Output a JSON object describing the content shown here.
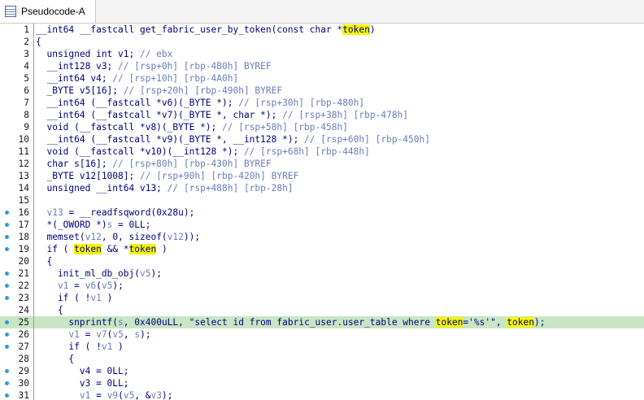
{
  "window": {
    "tab_title": "Pseudocode-A",
    "tab_icon": "pseudocode-window-icon"
  },
  "colors": {
    "keyword": "#000080",
    "comment": "#6b7dbd",
    "highlight_line": "#c8e6c3",
    "token_highlight": "#f5f500",
    "breakpoint_dot": "#2f9bd6"
  },
  "editor": {
    "highlighted_line": 25,
    "lines": [
      {
        "n": "1",
        "bp": false,
        "tokens": [
          [
            "__int64 __fastcall get_fabric_user_by_token(const char *",
            "k"
          ],
          [
            "token",
            "hw"
          ],
          [
            ")",
            "k"
          ]
        ]
      },
      {
        "n": "2",
        "bp": false,
        "tokens": [
          [
            "{",
            "k"
          ]
        ]
      },
      {
        "n": "3",
        "bp": false,
        "tokens": [
          [
            "  unsigned int v1; ",
            "k"
          ],
          [
            "// ebx",
            "c"
          ]
        ]
      },
      {
        "n": "4",
        "bp": false,
        "tokens": [
          [
            "  __int128 v3; ",
            "k"
          ],
          [
            "// [rsp+0h] [rbp-4B0h] BYREF",
            "c"
          ]
        ]
      },
      {
        "n": "5",
        "bp": false,
        "tokens": [
          [
            "  __int64 v4; ",
            "k"
          ],
          [
            "// [rsp+10h] [rbp-4A0h]",
            "c"
          ]
        ]
      },
      {
        "n": "6",
        "bp": false,
        "tokens": [
          [
            "  _BYTE v5[16]; ",
            "k"
          ],
          [
            "// [rsp+20h] [rbp-490h] BYREF",
            "c"
          ]
        ]
      },
      {
        "n": "7",
        "bp": false,
        "tokens": [
          [
            "  __int64 (__fastcall *v6)(_BYTE *); ",
            "k"
          ],
          [
            "// [rsp+30h] [rbp-480h]",
            "c"
          ]
        ]
      },
      {
        "n": "8",
        "bp": false,
        "tokens": [
          [
            "  __int64 (__fastcall *v7)(_BYTE *, char *); ",
            "k"
          ],
          [
            "// [rsp+38h] [rbp-478h]",
            "c"
          ]
        ]
      },
      {
        "n": "9",
        "bp": false,
        "tokens": [
          [
            "  void (__fastcall *v8)(_BYTE *); ",
            "k"
          ],
          [
            "// [rsp+58h] [rbp-458h]",
            "c"
          ]
        ]
      },
      {
        "n": "10",
        "bp": false,
        "tokens": [
          [
            "  __int64 (__fastcall *v9)(_BYTE *, __int128 *); ",
            "k"
          ],
          [
            "// [rsp+60h] [rbp-450h]",
            "c"
          ]
        ]
      },
      {
        "n": "11",
        "bp": false,
        "tokens": [
          [
            "  void (__fastcall *v10)(__int128 *); ",
            "k"
          ],
          [
            "// [rsp+68h] [rbp-448h]",
            "c"
          ]
        ]
      },
      {
        "n": "12",
        "bp": false,
        "tokens": [
          [
            "  char s[16]; ",
            "k"
          ],
          [
            "// [rsp+80h] [rbp-430h] BYREF",
            "c"
          ]
        ]
      },
      {
        "n": "13",
        "bp": false,
        "tokens": [
          [
            "  _BYTE v12[1008]; ",
            "k"
          ],
          [
            "// [rsp+90h] [rbp-420h] BYREF",
            "c"
          ]
        ]
      },
      {
        "n": "14",
        "bp": false,
        "tokens": [
          [
            "  unsigned __int64 v13; ",
            "k"
          ],
          [
            "// [rsp+488h] [rbp-28h]",
            "c"
          ]
        ]
      },
      {
        "n": "15",
        "bp": false,
        "tokens": []
      },
      {
        "n": "16",
        "bp": true,
        "tokens": [
          [
            "  ",
            "k"
          ],
          [
            "v13",
            "v"
          ],
          [
            " = __readfsqword(0x28u);",
            "k"
          ]
        ]
      },
      {
        "n": "17",
        "bp": true,
        "tokens": [
          [
            "  *(_OWORD *)",
            "k"
          ],
          [
            "s",
            "v"
          ],
          [
            " = 0LL;",
            "k"
          ]
        ]
      },
      {
        "n": "18",
        "bp": true,
        "tokens": [
          [
            "  memset(",
            "k"
          ],
          [
            "v12",
            "v"
          ],
          [
            ", 0, sizeof(",
            "k"
          ],
          [
            "v12",
            "v"
          ],
          [
            "));",
            "k"
          ]
        ]
      },
      {
        "n": "19",
        "bp": true,
        "tokens": [
          [
            "  if ( ",
            "k"
          ],
          [
            "token",
            "hw"
          ],
          [
            " && *",
            "k"
          ],
          [
            "token",
            "hw"
          ],
          [
            " )",
            "k"
          ]
        ]
      },
      {
        "n": "20",
        "bp": false,
        "tokens": [
          [
            "  {",
            "k"
          ]
        ]
      },
      {
        "n": "21",
        "bp": true,
        "tokens": [
          [
            "    init_ml_db_obj(",
            "k"
          ],
          [
            "v5",
            "v"
          ],
          [
            ");",
            "k"
          ]
        ]
      },
      {
        "n": "22",
        "bp": true,
        "tokens": [
          [
            "    ",
            "k"
          ],
          [
            "v1",
            "v"
          ],
          [
            " = ",
            "k"
          ],
          [
            "v6",
            "v"
          ],
          [
            "(",
            "k"
          ],
          [
            "v5",
            "v"
          ],
          [
            ");",
            "k"
          ]
        ]
      },
      {
        "n": "23",
        "bp": true,
        "tokens": [
          [
            "    if ( !",
            "k"
          ],
          [
            "v1",
            "v"
          ],
          [
            " )",
            "k"
          ]
        ]
      },
      {
        "n": "24",
        "bp": false,
        "tokens": [
          [
            "    {",
            "k"
          ]
        ]
      },
      {
        "n": "25",
        "bp": true,
        "tokens": [
          [
            "      snprintf(",
            "k"
          ],
          [
            "s",
            "v"
          ],
          [
            ", 0x400uLL, \"select id from fabric_user.user_table where ",
            "k"
          ],
          [
            "token",
            "hw"
          ],
          [
            "='%s'\", ",
            "k"
          ],
          [
            "token",
            "hw"
          ],
          [
            ");",
            "k"
          ]
        ]
      },
      {
        "n": "26",
        "bp": true,
        "tokens": [
          [
            "      ",
            "k"
          ],
          [
            "v1",
            "v"
          ],
          [
            " = ",
            "k"
          ],
          [
            "v7",
            "v"
          ],
          [
            "(",
            "k"
          ],
          [
            "v5",
            "v"
          ],
          [
            ", ",
            "k"
          ],
          [
            "s",
            "v"
          ],
          [
            ");",
            "k"
          ]
        ]
      },
      {
        "n": "27",
        "bp": true,
        "tokens": [
          [
            "      if ( !",
            "k"
          ],
          [
            "v1",
            "v"
          ],
          [
            " )",
            "k"
          ]
        ]
      },
      {
        "n": "28",
        "bp": false,
        "tokens": [
          [
            "      {",
            "k"
          ]
        ]
      },
      {
        "n": "29",
        "bp": true,
        "tokens": [
          [
            "        v4 = 0LL;",
            "k"
          ]
        ]
      },
      {
        "n": "30",
        "bp": true,
        "tokens": [
          [
            "        v3 = 0LL;",
            "k"
          ]
        ]
      },
      {
        "n": "31",
        "bp": true,
        "tokens": [
          [
            "        ",
            "k"
          ],
          [
            "v1",
            "v"
          ],
          [
            " = ",
            "k"
          ],
          [
            "v9",
            "v"
          ],
          [
            "(",
            "k"
          ],
          [
            "v5",
            "v"
          ],
          [
            ", &",
            "k"
          ],
          [
            "v3",
            "v"
          ],
          [
            ");",
            "k"
          ]
        ]
      }
    ]
  }
}
